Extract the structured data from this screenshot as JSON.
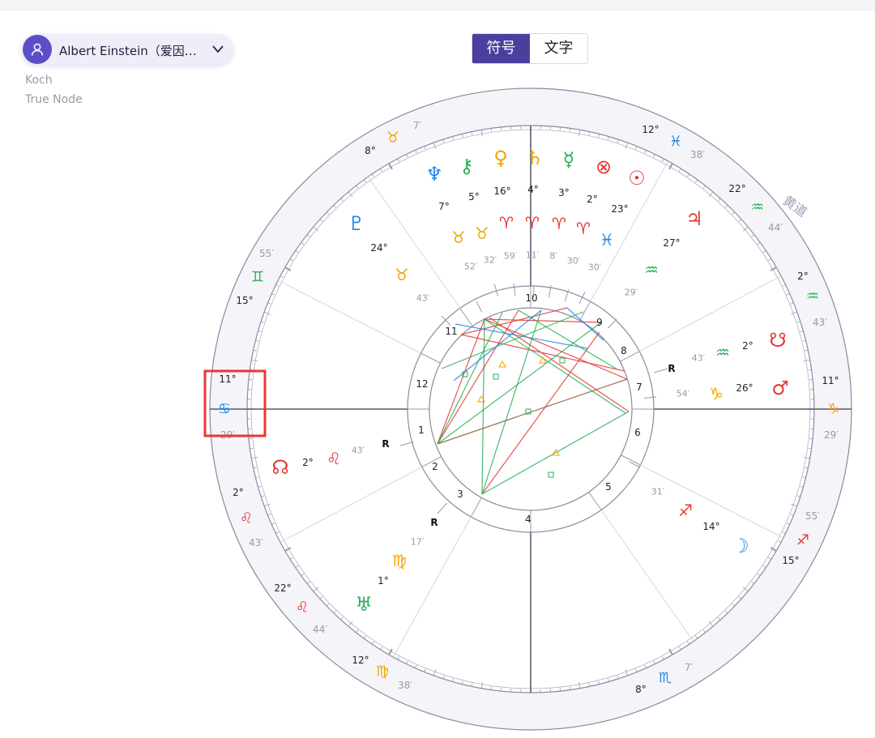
{
  "header": {
    "profile_name": "Albert Einstein（爱因…",
    "house_system": "Koch",
    "node_type": "True Node",
    "toggle": [
      {
        "label": "符号",
        "active": true
      },
      {
        "label": "文字",
        "active": false
      }
    ]
  },
  "colors": {
    "fire": "#e53935",
    "earth": "#f0a500",
    "air": "#27b05a",
    "water": "#1e88e5",
    "ring_bg": "#f4f4f9",
    "ring_stroke": "#8a8aa0",
    "highlight": "#e53935",
    "toggle_active": "#4b3f9e"
  },
  "chart": {
    "ecliptic_label": "黄道",
    "sign_cusps": [
      {
        "deg": "11°",
        "sym": "♋",
        "min": "29′",
        "color": "water"
      },
      {
        "deg": "2°",
        "sym": "♌",
        "min": "43′",
        "color": "fire"
      },
      {
        "deg": "22°",
        "sym": "♌",
        "min": "44′",
        "color": "fire"
      },
      {
        "deg": "12°",
        "sym": "♍",
        "min": "38′",
        "color": "earth"
      },
      {
        "deg": "8°",
        "sym": "♏",
        "min": "7′",
        "color": "water"
      },
      {
        "deg": "15°",
        "sym": "♐",
        "min": "55′",
        "color": "fire"
      },
      {
        "deg": "11°",
        "sym": "♑",
        "min": "29′",
        "color": "earth"
      },
      {
        "deg": "2°",
        "sym": "♒",
        "min": "43′",
        "color": "air"
      },
      {
        "deg": "22°",
        "sym": "♒",
        "min": "44′",
        "color": "air"
      },
      {
        "deg": "12°",
        "sym": "♓",
        "min": "38′",
        "color": "water"
      },
      {
        "deg": "8°",
        "sym": "♉",
        "min": "7′",
        "color": "earth"
      },
      {
        "deg": "15°",
        "sym": "♊",
        "min": "55′",
        "color": "air"
      }
    ],
    "planets": [
      {
        "name": "Neptune",
        "sym": "♆",
        "deg": "7°",
        "sign": "♉",
        "min": "52′",
        "color": "water",
        "sign_color": "earth",
        "retro": ""
      },
      {
        "name": "Chiron",
        "sym": "⚷",
        "deg": "5°",
        "sign": "♉",
        "min": "32′",
        "color": "air",
        "sign_color": "earth",
        "retro": ""
      },
      {
        "name": "Venus",
        "sym": "♀",
        "deg": "16°",
        "sign": "♈",
        "min": "59′",
        "color": "earth",
        "sign_color": "fire",
        "retro": ""
      },
      {
        "name": "Saturn",
        "sym": "♄",
        "deg": "4°",
        "sign": "♈",
        "min": "11′",
        "color": "earth",
        "sign_color": "fire",
        "retro": ""
      },
      {
        "name": "Mercury",
        "sym": "☿",
        "deg": "3°",
        "sign": "♈",
        "min": "8′",
        "color": "air",
        "sign_color": "fire",
        "retro": ""
      },
      {
        "name": "Part of Fortune",
        "sym": "⊗",
        "deg": "2°",
        "sign": "♈",
        "min": "30′",
        "color": "fire",
        "sign_color": "fire",
        "retro": ""
      },
      {
        "name": "Sun",
        "sym": "☉",
        "deg": "23°",
        "sign": "♓",
        "min": "30′",
        "color": "fire",
        "sign_color": "water",
        "retro": ""
      },
      {
        "name": "Pluto",
        "sym": "♇",
        "deg": "24°",
        "sign": "♉",
        "min": "43′",
        "color": "water",
        "sign_color": "earth",
        "retro": ""
      },
      {
        "name": "Jupiter",
        "sym": "♃",
        "deg": "27°",
        "sign": "♒",
        "min": "29′",
        "color": "fire",
        "sign_color": "air",
        "retro": ""
      },
      {
        "name": "South Node",
        "sym": "☋",
        "deg": "2°",
        "sign": "♒",
        "min": "43′",
        "color": "fire",
        "sign_color": "air",
        "retro": "R"
      },
      {
        "name": "Mars",
        "sym": "♂",
        "deg": "26°",
        "sign": "♑",
        "min": "54′",
        "color": "fire",
        "sign_color": "earth",
        "retro": ""
      },
      {
        "name": "Moon",
        "sym": "☽",
        "deg": "14°",
        "sign": "♐",
        "min": "31′",
        "color": "water",
        "sign_color": "fire",
        "retro": ""
      },
      {
        "name": "North Node",
        "sym": "☊",
        "deg": "2°",
        "sign": "♌",
        "min": "43′",
        "color": "fire",
        "sign_color": "fire",
        "retro": "R"
      },
      {
        "name": "Uranus",
        "sym": "♅",
        "deg": "1°",
        "sign": "♍",
        "min": "17′",
        "color": "air",
        "sign_color": "earth",
        "retro": "R"
      }
    ],
    "houses": [
      "1",
      "2",
      "3",
      "4",
      "5",
      "6",
      "7",
      "8",
      "9",
      "10",
      "11",
      "12"
    ]
  }
}
